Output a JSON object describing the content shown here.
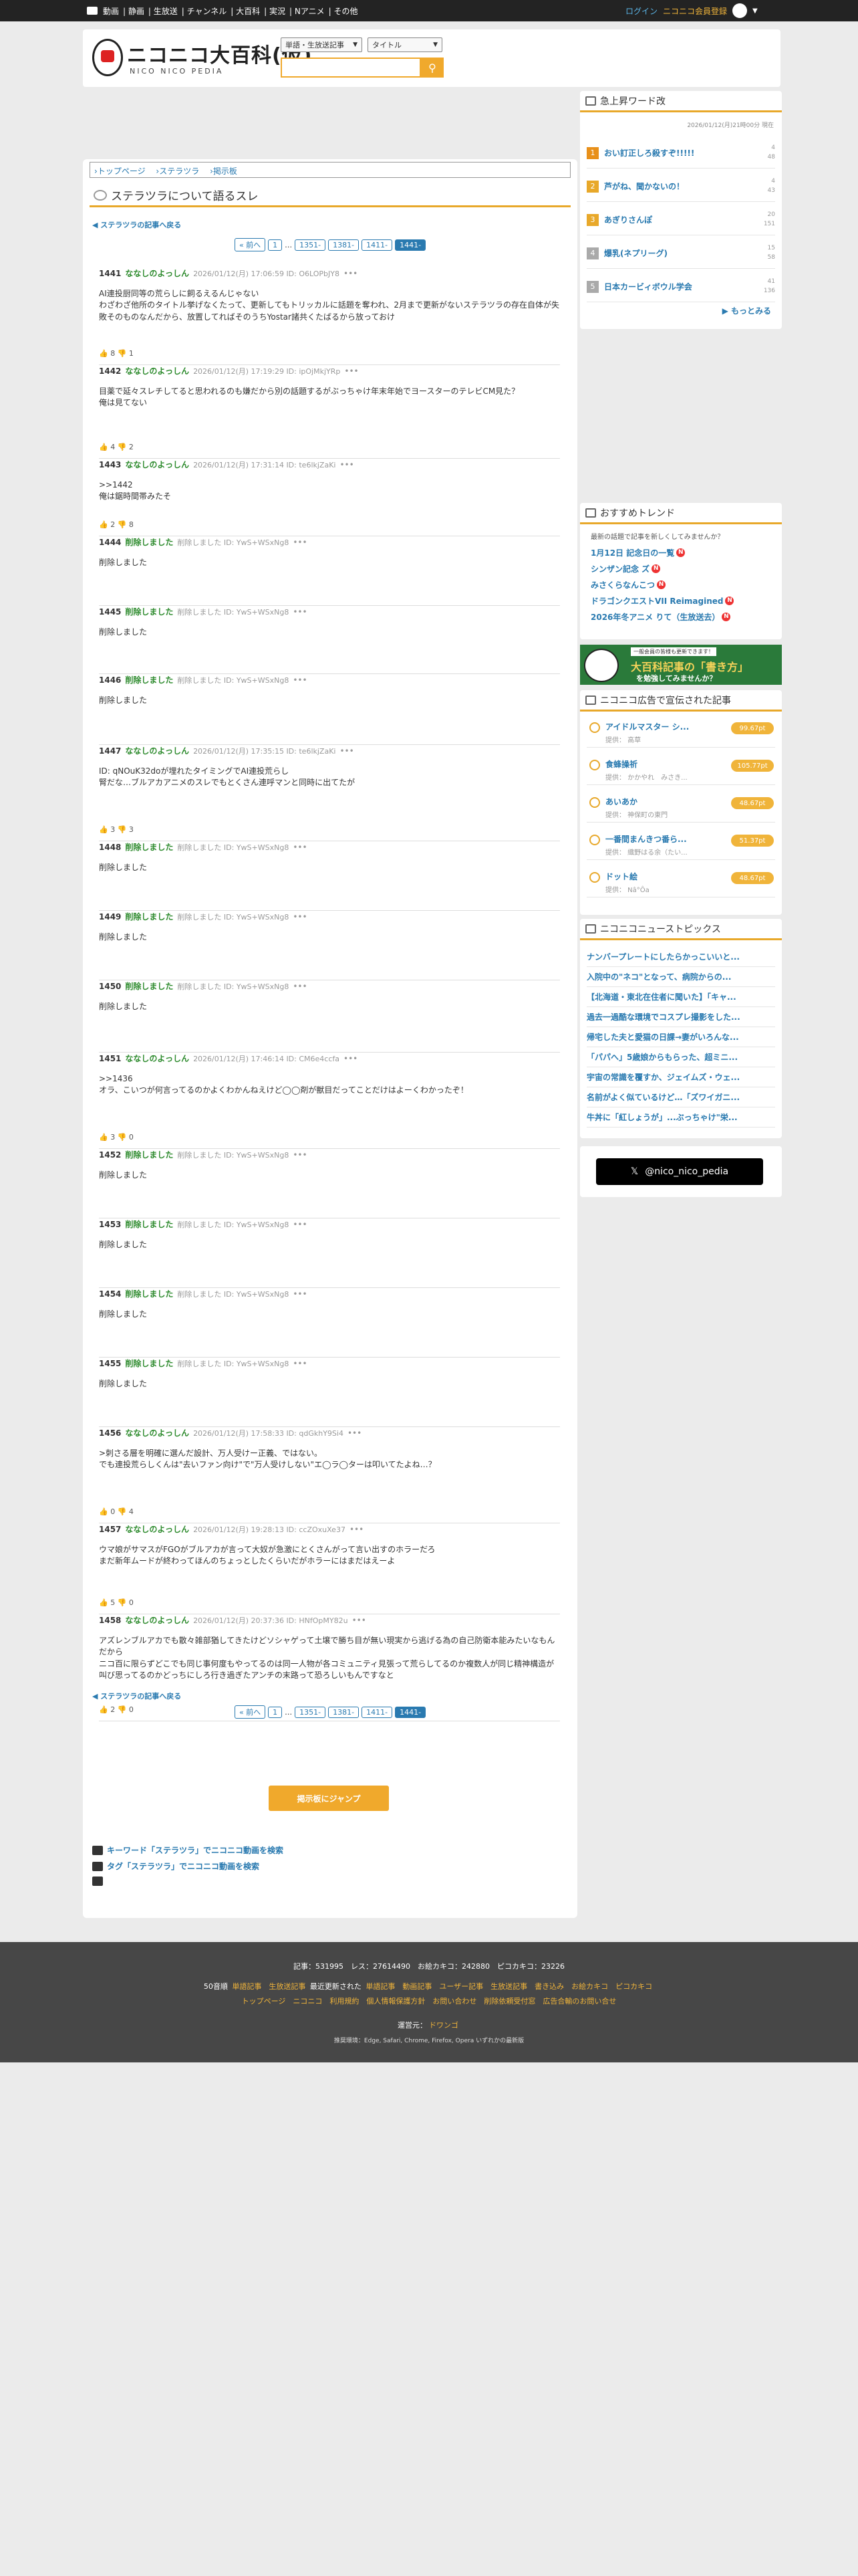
{
  "topbar": {
    "nav": [
      "動画",
      "静画",
      "生放送",
      "チャンネル",
      "大百科",
      "実況",
      "Nアニメ",
      "その他"
    ],
    "login": "ログイン",
    "register": "ニコニコ会員登録"
  },
  "header": {
    "logo_text": "ニコニコ大百科(仮)",
    "logo_sub": "NICO NICO PEDIA",
    "select1": "単語・生放送記事",
    "select2": "タイトル"
  },
  "main": {
    "breadcrumb": [
      "トップページ",
      "ステラツラ",
      "掲示板"
    ],
    "title": "ステラツラについて語るスレ",
    "back_link": "ステラツラの記事へ戻る",
    "pager": {
      "prev": "« 前へ",
      "first": "1",
      "pages": [
        "1351-",
        "1381-",
        "1411-",
        "1441-"
      ]
    },
    "posts": [
      {
        "no": "1441",
        "name": "ななしのよっしん",
        "meta": "2026/01/12(月) 17:06:59 ID: O6LOPbJY8",
        "body": "AI連投厨同等の荒らしに飼るえるんじゃない\nわざわざ他所のタイトル挙げなくたって、更新してもトリッカルに話題を奪われ、2月まで更新がないステラツラの存在自体が失敗そのものなんだから、放置してればそのうちYostar諸共くたばるから放っておけ",
        "fb": "👍 8 👎 1"
      },
      {
        "no": "1442",
        "name": "ななしのよっしん",
        "meta": "2026/01/12(月) 17:19:29 ID: ipOjMkjYRp",
        "body": "目薬で延々スレチしてると思われるのも嫌だから別の話題するがぶっちゃけ年末年始でヨースターのテレビCM見た？\n俺は見てない",
        "fb": "👍 4 👎 2"
      },
      {
        "no": "1443",
        "name": "ななしのよっしん",
        "meta": "2026/01/12(月) 17:31:14 ID: te6lkjZaKi",
        "body": ">>1442\n俺は鋸時間帯みたそ",
        "fb": "👍 2 👎 8"
      },
      {
        "no": "1444",
        "name": "削除しました",
        "meta": "削除しました ID: YwS+WSxNg8",
        "body": "削除しました",
        "fb": ""
      },
      {
        "no": "1445",
        "name": "削除しました",
        "meta": "削除しました ID: YwS+WSxNg8",
        "body": "削除しました",
        "fb": ""
      },
      {
        "no": "1446",
        "name": "削除しました",
        "meta": "削除しました ID: YwS+WSxNg8",
        "body": "削除しました",
        "fb": ""
      },
      {
        "no": "1447",
        "name": "ななしのよっしん",
        "meta": "2026/01/12(月) 17:35:15 ID: te6lkjZaKi",
        "body": "ID: qNOuK32doが埋れたタイミングでAI連投荒らし\n腎だな…ブルアカアニメのスレでもとくさん連呼マンと同時に出てたが",
        "fb": "👍 3 👎 3"
      },
      {
        "no": "1448",
        "name": "削除しました",
        "meta": "削除しました ID: YwS+WSxNg8",
        "body": "削除しました",
        "fb": ""
      },
      {
        "no": "1449",
        "name": "削除しました",
        "meta": "削除しました ID: YwS+WSxNg8",
        "body": "削除しました",
        "fb": ""
      },
      {
        "no": "1450",
        "name": "削除しました",
        "meta": "削除しました ID: YwS+WSxNg8",
        "body": "削除しました",
        "fb": ""
      },
      {
        "no": "1451",
        "name": "ななしのよっしん",
        "meta": "2026/01/12(月) 17:46:14 ID: CM6e4ccfa",
        "body": ">>1436\nオラ、こいつが何言ってるのかよくわかんねえけど◯◯剤が獣目だってことだけはよーくわかったぞ！",
        "fb": "👍 3 👎 0"
      },
      {
        "no": "1452",
        "name": "削除しました",
        "meta": "削除しました ID: YwS+WSxNg8",
        "body": "削除しました",
        "fb": ""
      },
      {
        "no": "1453",
        "name": "削除しました",
        "meta": "削除しました ID: YwS+WSxNg8",
        "body": "削除しました",
        "fb": ""
      },
      {
        "no": "1454",
        "name": "削除しました",
        "meta": "削除しました ID: YwS+WSxNg8",
        "body": "削除しました",
        "fb": ""
      },
      {
        "no": "1455",
        "name": "削除しました",
        "meta": "削除しました ID: YwS+WSxNg8",
        "body": "削除しました",
        "fb": ""
      },
      {
        "no": "1456",
        "name": "ななしのよっしん",
        "meta": "2026/01/12(月) 17:58:33 ID: qdGkhY9Si4",
        "body": ">刺さる層を明確に選んだ設計、万人受けー正義、ではない。\nでも連投荒らしくんは\"去いファン向け\"で\"万人受けしない\"エ◯ラ◯ターは叩いてたよね…？",
        "fb": "👍 0 👎 4"
      },
      {
        "no": "1457",
        "name": "ななしのよっしん",
        "meta": "2026/01/12(月) 19:28:13 ID: ccZOxuXe37",
        "body": "ウマ娘がサマスがFGOがブルアカが言って大奴が急激にとくさんがって言い出すのホラーだろ\nまだ新年ムードが終わってほんのちょっとしたくらいだがホラーにはまだはえーよ",
        "fb": "👍 5 👎 0"
      },
      {
        "no": "1458",
        "name": "ななしのよっしん",
        "meta": "2026/01/12(月) 20:37:36 ID: HNfOpMY82u",
        "body": "アズレンブルアカでも散々雑部猶してきたけどソシャゲって土壌で勝ち目が無い現実から逃げる為の自己防衛本能みたいなもんだから\nニコ百に限らずどこでも同じ事何度もやってるのは同一人物が各コミュニティ見張って荒らしてるのか複数人が同じ精神構造が叫び思ってるのかどっちにしろ行き過ぎたアンチの末路って恐ろしいもんですなと",
        "fb": "👍 2 👎 0"
      }
    ],
    "show_all": "掲示板にジャンプ",
    "search_kw": "キーワード「ステラツラ」でニコニコ動画を検索",
    "search_tag": "タグ「ステラツラ」でニコニコ動画を検索"
  },
  "sidebar": {
    "rising": {
      "title": "急上昇ワード改",
      "updated": "2026/01/12(月)21時00分 現在",
      "items": [
        {
          "rank": "1",
          "word": "おい訂正しろ殺すぞ!!!!!",
          "c1": "4",
          "c2": "48",
          "color": "#e8901a"
        },
        {
          "rank": "2",
          "word": "芦がね、聞かないの！",
          "c1": "4",
          "c2": "43",
          "color": "#e8a82a"
        },
        {
          "rank": "3",
          "word": "あぎりさんぽ",
          "c1": "20",
          "c2": "151",
          "color": "#e8a82a"
        },
        {
          "rank": "4",
          "word": "爆乳(ネプリーグ)",
          "c1": "15",
          "c2": "58",
          "color": "#aaaaaa"
        },
        {
          "rank": "5",
          "word": "日本カービィボウル学会",
          "c1": "41",
          "c2": "136",
          "color": "#aaaaaa"
        }
      ],
      "more": "もっとみる"
    },
    "trend": {
      "title": "おすすめトレンド",
      "desc": "最新の話題で記事を新しくしてみませんか？",
      "items": [
        "1月12日 記念日の一覧",
        "シンザン記念 ズ",
        "みさくらなんこつ",
        "ドラゴンクエストVII Reimagined",
        "2026年冬アニメ りて（生放送去）"
      ]
    },
    "banner": {
      "small": "一般会員の皆様も更新できます！",
      "main": "大百科記事の「書き方」",
      "sub": "を勉強してみませんか？"
    },
    "ads": {
      "title": "ニコニコ広告で宣伝された記事",
      "items": [
        {
          "title": "アイドルマスター シ...",
          "sub": "提供： 高草",
          "pt": "99.67pt"
        },
        {
          "title": "食蜂操祈",
          "sub": "提供： かかやれ　みさき...",
          "pt": "105.77pt"
        },
        {
          "title": "あいあか",
          "sub": "提供： 神保町の東門",
          "pt": "48.67pt"
        },
        {
          "title": "一番間まんきつ番ら...",
          "sub": "提供： 織野はる余（たい...",
          "pt": "51.37pt"
        },
        {
          "title": "ドット絵",
          "sub": "提供： Nâ°Ôa",
          "pt": "48.67pt"
        }
      ]
    },
    "news": {
      "title": "ニコニコニューストピックス",
      "items": [
        "ナンバープレートにしたらかっこいいと...",
        "入院中の\"ネコ\"となって、病院からの...",
        "【北海道・東北在住者に聞いた】「キャ...",
        "過去一過酷な環境でコスプレ撮影をした...",
        "帰宅した夫と愛猫の日課→妻がいろんな...",
        "「パパへ」5歳娘からもらった、超ミニ...",
        "宇宙の常識を覆すか、ジェイムズ・ウェ...",
        "名前がよく似ているけど…「ズワイガニ...",
        "牛丼に「紅しょうが」...ぶっちゃけ\"栄..."
      ]
    },
    "xlink": "@nico_nico_pedia"
  },
  "footer": {
    "stats": "記事：531995　レス：27614490　お絵カキコ：242880　ピコカキコ：23226",
    "line2_a": "50音順",
    "line2_b": "単語記事　生放送記事",
    "line2_c": "最近更新された",
    "line2_d": "単語記事　動画記事　ユーザー記事　生放送記事　書き込み　お絵カキコ　ピコカキコ",
    "line3": "トップページ　ニコニコ　利用規約　個人情報保護方針　お問い合わせ　削除依頼受付窓　広告合輸のお問い合せ",
    "operator_label": "運営元：",
    "operator": "ドワンゴ",
    "env": "推奨環境：Edge, Safari, Chrome, Firefox, Opera いずれかの最新版"
  }
}
